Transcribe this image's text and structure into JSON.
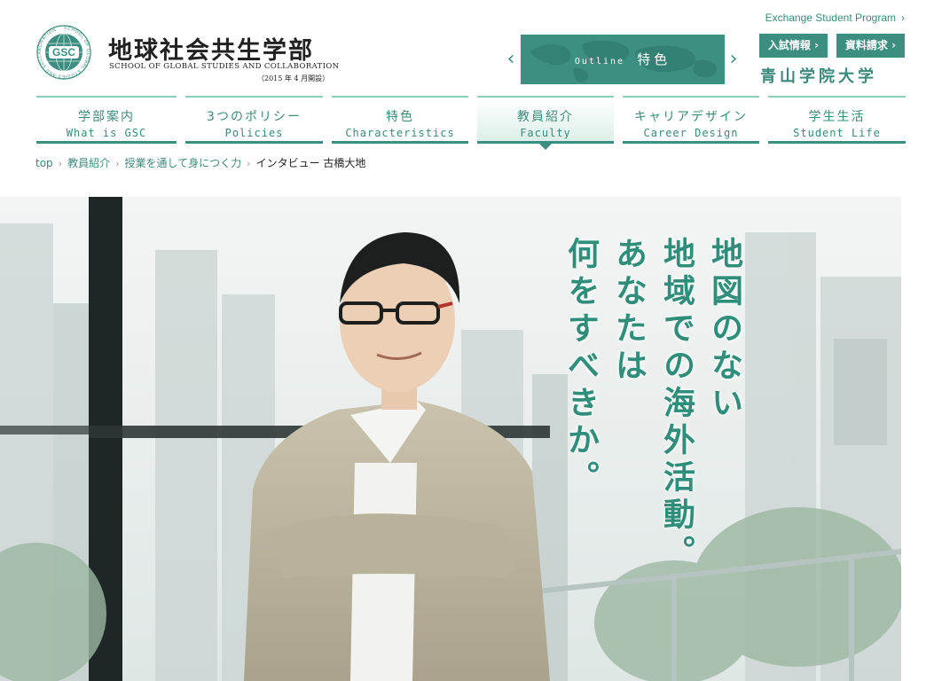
{
  "header": {
    "logo": {
      "emblem_text": "GSC",
      "ring_text": "SCHOOL OF GLOBAL STUDIES AND COLLABORATION",
      "title_jp": "地球社会共生学部",
      "title_en": "SCHOOL OF GLOBAL STUDIES AND COLLABORATION",
      "opening": "（2015 年 4 月開設）"
    },
    "exchange_link": "Exchange Student Program",
    "banner": {
      "label_en": "Outline",
      "label_jp": "特色"
    },
    "buttons": {
      "entrance": "入試情報",
      "request": "資料請求"
    },
    "university": "青山学院大学",
    "colors": {
      "accent": "#3c8f80",
      "light_accent": "#8fcbbf"
    }
  },
  "nav": [
    {
      "jp": "学部案内",
      "en": "What is GSC"
    },
    {
      "jp": "3つのポリシー",
      "en": "Policies"
    },
    {
      "jp": "特色",
      "en": "Characteristics"
    },
    {
      "jp": "教員紹介",
      "en": "Faculty"
    },
    {
      "jp": "キャリアデザイン",
      "en": "Career Design"
    },
    {
      "jp": "学生生活",
      "en": "Student Life"
    }
  ],
  "breadcrumb": {
    "items": [
      "top",
      "教員紹介",
      "授業を通して身につく力"
    ],
    "current": "インタビュー 古橋大地"
  },
  "hero": {
    "lines": [
      "地図のない",
      "地域での海外活動。",
      "あなたは",
      "何をすべきか。"
    ]
  }
}
